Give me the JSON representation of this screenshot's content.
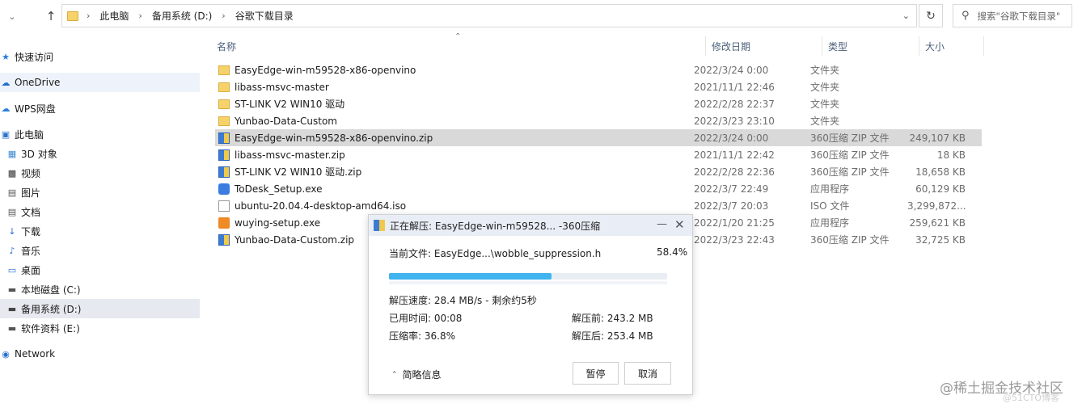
{
  "address": {
    "crumbs": [
      "此电脑",
      "备用系统 (D:)",
      "谷歌下载目录"
    ],
    "search_placeholder": "搜索\"谷歌下载目录\""
  },
  "sidebar": {
    "items": [
      {
        "label": "快速访问",
        "icon": "star-icon"
      },
      {
        "label": "OneDrive",
        "icon": "cloud-icon"
      },
      {
        "label": "WPS网盘",
        "icon": "cloud-icon"
      },
      {
        "label": "此电脑",
        "icon": "computer-icon"
      },
      {
        "label": "3D 对象",
        "icon": "cube-icon"
      },
      {
        "label": "视频",
        "icon": "video-icon"
      },
      {
        "label": "图片",
        "icon": "picture-icon"
      },
      {
        "label": "文档",
        "icon": "document-icon"
      },
      {
        "label": "下载",
        "icon": "download-icon"
      },
      {
        "label": "音乐",
        "icon": "music-icon"
      },
      {
        "label": "桌面",
        "icon": "desktop-icon"
      },
      {
        "label": "本地磁盘 (C:)",
        "icon": "drive-icon"
      },
      {
        "label": "备用系统 (D:)",
        "icon": "drive-icon"
      },
      {
        "label": "软件资料 (E:)",
        "icon": "drive-icon"
      },
      {
        "label": "Network",
        "icon": "network-icon"
      }
    ]
  },
  "columns": {
    "name": "名称",
    "date": "修改日期",
    "type": "类型",
    "size": "大小"
  },
  "files": [
    {
      "name": "EasyEdge-win-m59528-x86-openvino",
      "date": "2022/3/24 0:00",
      "type": "文件夹",
      "size": "",
      "icon": "folder"
    },
    {
      "name": "libass-msvc-master",
      "date": "2021/11/1 22:46",
      "type": "文件夹",
      "size": "",
      "icon": "folder"
    },
    {
      "name": "ST-LINK V2  WIN10 驱动",
      "date": "2022/2/28 22:37",
      "type": "文件夹",
      "size": "",
      "icon": "folder"
    },
    {
      "name": "Yunbao-Data-Custom",
      "date": "2022/3/23 23:10",
      "type": "文件夹",
      "size": "",
      "icon": "folder"
    },
    {
      "name": "EasyEdge-win-m59528-x86-openvino.zip",
      "date": "2022/3/24 0:00",
      "type": "360压缩 ZIP 文件",
      "size": "249,107 KB",
      "icon": "zip"
    },
    {
      "name": "libass-msvc-master.zip",
      "date": "2021/11/1 22:42",
      "type": "360压缩 ZIP 文件",
      "size": "18 KB",
      "icon": "zip"
    },
    {
      "name": "ST-LINK V2  WIN10 驱动.zip",
      "date": "2022/2/28 22:36",
      "type": "360压缩 ZIP 文件",
      "size": "18,658 KB",
      "icon": "zip"
    },
    {
      "name": "ToDesk_Setup.exe",
      "date": "2022/3/7 22:49",
      "type": "应用程序",
      "size": "60,129 KB",
      "icon": "exe"
    },
    {
      "name": "ubuntu-20.04.4-desktop-amd64.iso",
      "date": "2022/3/7 20:03",
      "type": "ISO 文件",
      "size": "3,299,872...",
      "icon": "iso"
    },
    {
      "name": "wuying-setup.exe",
      "date": "2022/1/20 21:25",
      "type": "应用程序",
      "size": "259,621 KB",
      "icon": "wuying"
    },
    {
      "name": "Yunbao-Data-Custom.zip",
      "date": "2022/3/23 22:43",
      "type": "360压缩 ZIP 文件",
      "size": "32,725 KB",
      "icon": "zip"
    }
  ],
  "dialog": {
    "title": "正在解压: EasyEdge-win-m59528... -360压缩",
    "current_file_label": "当前文件: EasyEdge...\\wobble_suppression.h",
    "percent": "58.4%",
    "progress_fraction": 0.584,
    "speed": "解压速度: 28.4 MB/s     - 剩余约5秒",
    "elapsed": "已用时间: 00:08",
    "ratio": "压缩率:    36.8%",
    "before": "解压前: 243.2 MB",
    "after": "解压后: 253.4 MB",
    "toggle_label": "简略信息",
    "pause_label": "暂停",
    "cancel_label": "取消"
  },
  "watermark": "@稀土掘金技术社区",
  "watermark2": "@51CTO博客"
}
